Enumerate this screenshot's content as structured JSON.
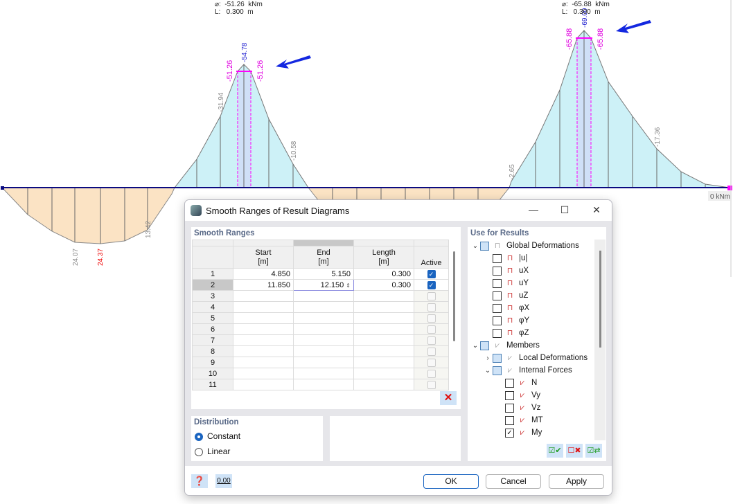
{
  "diagram": {
    "info_left": {
      "value_line": "⌀:  -51.26  kNm",
      "length_line": "L:   0.300  m"
    },
    "info_right": {
      "value_line": "⌀:  -65.88  kNm",
      "length_line": "L:   0.300  m"
    },
    "labels": {
      "peak1_max": "-54.78",
      "peak1_smooth_left": "-51.26",
      "peak1_smooth_right": "-51.26",
      "peak2_max": "-69.00",
      "peak2_smooth_left": "-65.88",
      "peak2_smooth_right": "-65.88",
      "v1": "24.07",
      "v2": "24.37",
      "v3": "13.42",
      "v4": "-31.94",
      "v5": "-10.58",
      "v6": "-2.65",
      "v7": "-17.36",
      "zero": "0 kNm"
    },
    "colors": {
      "positive": "#fbe3c4",
      "negative": "#cdf1f7",
      "smooth": "#ff00ff",
      "arrow": "#1428e0",
      "member": "#0a0a80"
    }
  },
  "dialog": {
    "title": "Smooth Ranges of Result Diagrams",
    "smooth_ranges": {
      "title": "Smooth Ranges",
      "headers": {
        "start": "Start",
        "start_unit": "[m]",
        "end": "End",
        "end_unit": "[m]",
        "length": "Length",
        "length_unit": "[m]",
        "active": "Active"
      },
      "rows": [
        {
          "n": "1",
          "start": "4.850",
          "end": "5.150",
          "length": "0.300",
          "active": true
        },
        {
          "n": "2",
          "start": "11.850",
          "end": "12.150",
          "length": "0.300",
          "active": true
        },
        {
          "n": "3",
          "start": "",
          "end": "",
          "length": "",
          "active": false
        },
        {
          "n": "4",
          "start": "",
          "end": "",
          "length": "",
          "active": false
        },
        {
          "n": "5",
          "start": "",
          "end": "",
          "length": "",
          "active": false
        },
        {
          "n": "6",
          "start": "",
          "end": "",
          "length": "",
          "active": false
        },
        {
          "n": "7",
          "start": "",
          "end": "",
          "length": "",
          "active": false
        },
        {
          "n": "8",
          "start": "",
          "end": "",
          "length": "",
          "active": false
        },
        {
          "n": "9",
          "start": "",
          "end": "",
          "length": "",
          "active": false
        },
        {
          "n": "10",
          "start": "",
          "end": "",
          "length": "",
          "active": false
        },
        {
          "n": "11",
          "start": "",
          "end": "",
          "length": "",
          "active": false
        }
      ]
    },
    "distribution": {
      "title": "Distribution",
      "options": [
        "Constant",
        "Linear"
      ],
      "selected": "Constant"
    },
    "use_for_results": {
      "title": "Use for Results",
      "items": [
        {
          "label": "Global Deformations",
          "level": 0,
          "expander": "⌄",
          "state": "partial",
          "icon": "frame"
        },
        {
          "label": "|u|",
          "level": 1,
          "state": "off",
          "icon": "frame-red"
        },
        {
          "label": "uX",
          "level": 1,
          "state": "off",
          "icon": "frame-red"
        },
        {
          "label": "uY",
          "level": 1,
          "state": "off",
          "icon": "frame-red"
        },
        {
          "label": "uZ",
          "level": 1,
          "state": "off",
          "icon": "frame-red"
        },
        {
          "label": "φX",
          "level": 1,
          "state": "off",
          "icon": "frame-red"
        },
        {
          "label": "φY",
          "level": 1,
          "state": "off",
          "icon": "frame-red"
        },
        {
          "label": "φZ",
          "level": 1,
          "state": "off",
          "icon": "frame-red"
        },
        {
          "label": "Members",
          "level": 0,
          "expander": "⌄",
          "state": "partial",
          "icon": "member"
        },
        {
          "label": "Local Deformations",
          "level": 1,
          "expander": "›",
          "state": "partial",
          "icon": "member"
        },
        {
          "label": "Internal Forces",
          "level": 1,
          "expander": "⌄",
          "state": "partial",
          "icon": "member"
        },
        {
          "label": "N",
          "level": 2,
          "state": "off",
          "icon": "diagram"
        },
        {
          "label": "Vy",
          "level": 2,
          "state": "off",
          "icon": "diagram"
        },
        {
          "label": "Vz",
          "level": 2,
          "state": "off",
          "icon": "diagram"
        },
        {
          "label": "MT",
          "level": 2,
          "state": "off",
          "icon": "diagram"
        },
        {
          "label": "My",
          "level": 2,
          "state": "on",
          "icon": "diagram"
        }
      ]
    },
    "buttons": {
      "ok": "OK",
      "cancel": "Cancel",
      "apply": "Apply",
      "number_format": "0,00"
    }
  }
}
